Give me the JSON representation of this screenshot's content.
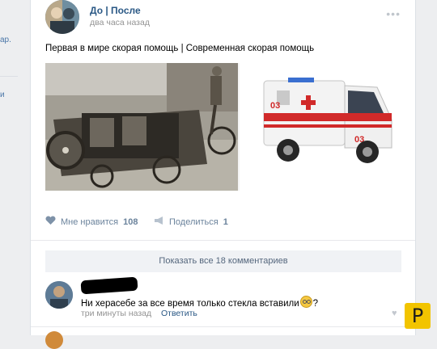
{
  "left_nav": {
    "fragment_1": "ар.",
    "fragment_2": "и"
  },
  "post": {
    "author": "До | После",
    "time": "два часа назад",
    "caption": "Первая в мире скорая помощь | Современная скорая помощь",
    "more_icon": "more-dots-icon",
    "ambulance_number": "03"
  },
  "actions": {
    "like_label": "Мне нравится",
    "like_count": "108",
    "share_label": "Поделиться",
    "share_count": "1"
  },
  "comments": {
    "show_all_label": "Показать все 18 комментариев",
    "items": [
      {
        "text": "Ни херасебе за все время только стекла вставили",
        "text_suffix": "?",
        "time": "три минуты назад",
        "reply_label": "Ответить"
      }
    ]
  },
  "badge": {
    "label": "Р"
  },
  "colors": {
    "link": "#2a5885",
    "muted": "#939393",
    "action": "#6b839c",
    "page_bg": "#edeef0",
    "badge_bg": "#f2c400"
  }
}
